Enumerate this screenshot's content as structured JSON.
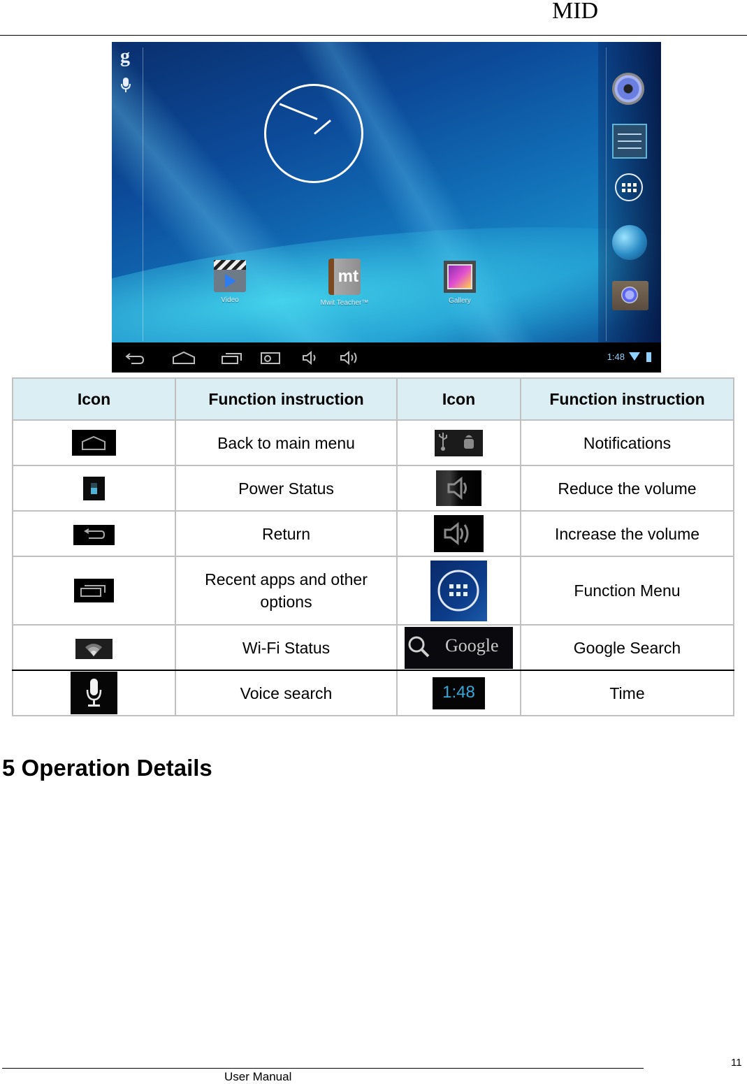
{
  "header": {
    "title": "MID"
  },
  "screenshot": {
    "search_glyph": "g",
    "apps": [
      {
        "label": "Video"
      },
      {
        "label": "Mwit Teacher™",
        "glyph": "mt"
      },
      {
        "label": "Gallery"
      }
    ],
    "dock": [
      "music-icon",
      "settings-icon",
      "all-apps-icon",
      "browser-globe-icon",
      "camera-icon"
    ],
    "navbar": [
      "back-icon",
      "home-icon",
      "recent-apps-icon",
      "screenshot-icon",
      "volume-down-icon",
      "volume-up-icon"
    ],
    "status": {
      "time": "1:48"
    }
  },
  "table": {
    "headers": [
      "Icon",
      "Function instruction",
      "Icon",
      "Function instruction"
    ],
    "rows": [
      {
        "left_icon": "home-icon",
        "left_text": "Back to main menu",
        "right_icon": "notifications-icon",
        "right_text": "Notifications"
      },
      {
        "left_icon": "battery-icon",
        "left_text": "Power Status",
        "right_icon": "volume-down-icon",
        "right_text": "Reduce the volume"
      },
      {
        "left_icon": "return-icon",
        "left_text": "Return",
        "right_icon": "volume-up-icon",
        "right_text": "Increase the volume"
      },
      {
        "left_icon": "recent-apps-icon",
        "left_text": "Recent apps and other options",
        "right_icon": "function-menu-icon",
        "right_text": "Function Menu"
      },
      {
        "left_icon": "wifi-icon",
        "left_text": "Wi-Fi Status",
        "right_icon": "google-search-icon",
        "right_text": "Google Search",
        "right_icon_text": "Google"
      },
      {
        "left_icon": "voice-search-icon",
        "left_text": "Voice search",
        "right_icon": "time-icon",
        "right_text": "Time",
        "right_icon_text": "1:48"
      }
    ]
  },
  "section": {
    "title": "5 Operation Details"
  },
  "footer": {
    "label": "User Manual",
    "page": "11"
  }
}
